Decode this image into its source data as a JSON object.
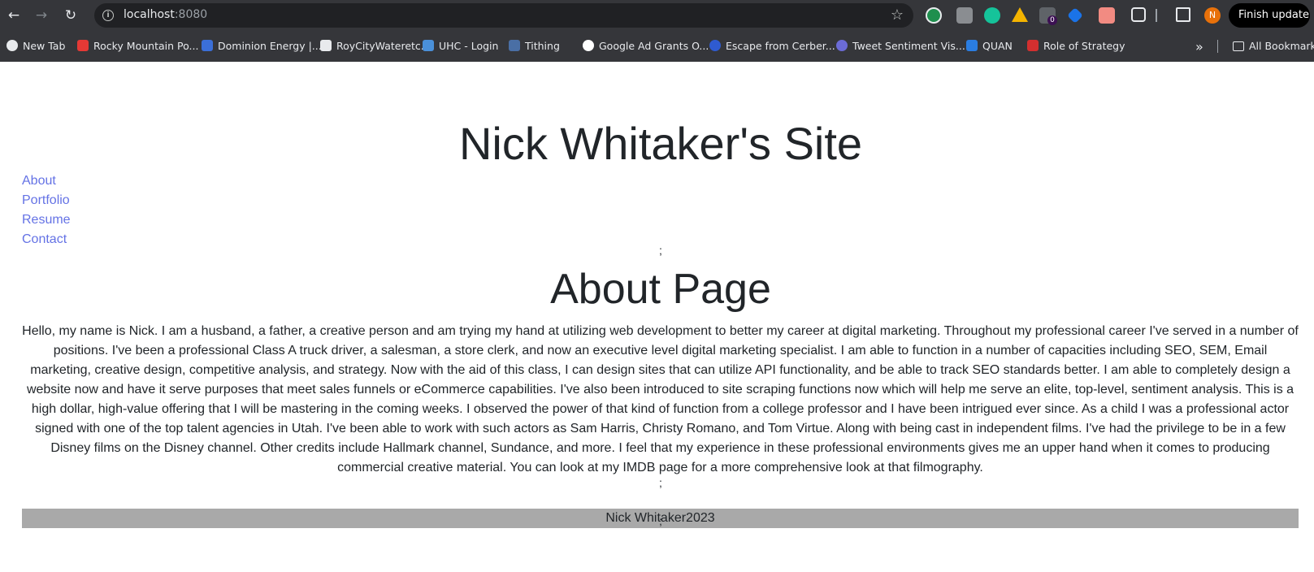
{
  "browser": {
    "url_host": "localhost",
    "url_port": ":8080",
    "finish_update_label": "Finish update",
    "profile_initial": "N",
    "extension_badge": "0",
    "bookmarks": [
      {
        "label": "New Tab",
        "icon": "globe-icon",
        "color": "#e8eaed"
      },
      {
        "label": "Rocky Mountain Po...",
        "icon": "rmp-icon",
        "color": "#e53935"
      },
      {
        "label": "Dominion Energy |...",
        "icon": "dominion-icon",
        "color": "#3b6fd8"
      },
      {
        "label": "RoyCityWateretc.",
        "icon": "page-icon",
        "color": "#e8eaed"
      },
      {
        "label": "UHC - Login",
        "icon": "uhc-icon",
        "color": "#4a90d9"
      },
      {
        "label": "Tithing",
        "icon": "church-icon",
        "color": "#4a6fa5"
      },
      {
        "label": "Google Ad Grants O...",
        "icon": "google-icon",
        "color": "#ffffff"
      },
      {
        "label": "Escape from Cerber...",
        "icon": "cerber-icon",
        "color": "#2f5bd1"
      },
      {
        "label": "Tweet Sentiment Vis...",
        "icon": "tweet-icon",
        "color": "#6b6bd6"
      },
      {
        "label": "QUAN",
        "icon": "quan-icon",
        "color": "#2a7de1"
      },
      {
        "label": "Role of Strategy",
        "icon": "strategy-icon",
        "color": "#d32f2f"
      }
    ],
    "all_bookmarks_label": "All Bookmarks"
  },
  "site": {
    "title": "Nick Whitaker's Site",
    "nav": [
      "About",
      "Portfolio",
      "Resume",
      "Contact"
    ],
    "separator": ";",
    "about_heading": "About Page",
    "about_body": "Hello, my name is Nick. I am a husband, a father, a creative person and am trying my hand at utilizing web development to better my career at digital marketing. Throughout my professional career I've served in a number of positions. I've been a professional Class A truck driver, a salesman, a store clerk, and now an executive level digital marketing specialist. I am able to function in a number of capacities including SEO, SEM, Email marketing, creative design, competitive analysis, and strategy. Now with the aid of this class, I can design sites that can utilize API functionality, and be able to track SEO standards better. I am able to completely design a website now and have it serve purposes that meet sales funnels or eCommerce capabilities. I've also been introduced to site scraping functions now which will help me serve an elite, top-level, sentiment analysis. This is a high dollar, high-value offering that I will be mastering in the coming weeks. I observed the power of that kind of function from a college professor and I have been intrigued ever since. As a child I was a professional actor signed with one of the top talent agencies in Utah. I've been able to work with such actors as Sam Harris, Christy Romano, and Tom Virtue. Along with being cast in independent films. I've had the privilege to be in a few Disney films on the Disney channel. Other credits include Hallmark channel, Sundance, and more. I feel that my experience in these professional environments gives me an upper hand when it comes to producing commercial creative material. You can look at my IMDB page for a more comprehensive look at that filmography.",
    "footer": "Nick Whitaker2023"
  }
}
